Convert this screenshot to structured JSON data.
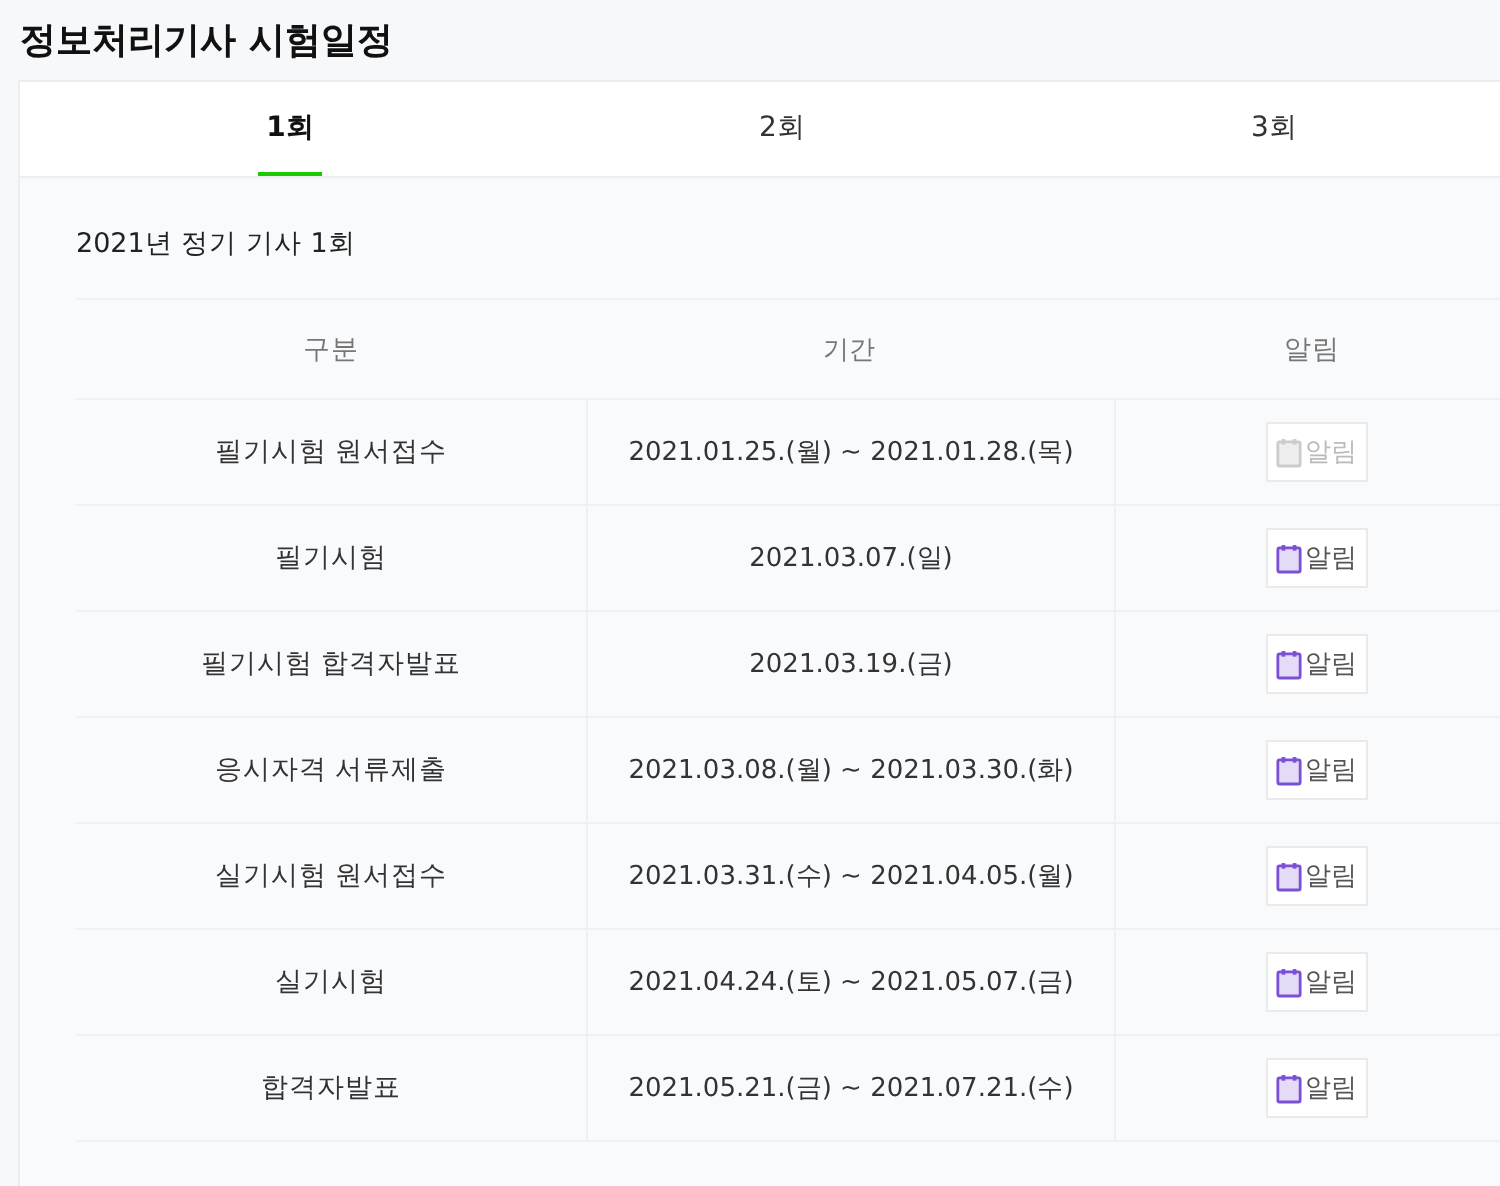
{
  "title": "정보처리기사 시험일정",
  "tabs": [
    {
      "label": "1회",
      "selected": true
    },
    {
      "label": "2회",
      "selected": false
    },
    {
      "label": "3회",
      "selected": false
    }
  ],
  "section_title": "2021년 정기 기사 1회",
  "table": {
    "columns": [
      "구분",
      "기간",
      "알림"
    ],
    "rows": [
      {
        "name": "필기시험 원서접수",
        "period": "2021.01.25.(월) ~ 2021.01.28.(목)",
        "alarm": "알림",
        "disabled": true
      },
      {
        "name": "필기시험",
        "period": "2021.03.07.(일)",
        "alarm": "알림",
        "disabled": false
      },
      {
        "name": "필기시험 합격자발표",
        "period": "2021.03.19.(금)",
        "alarm": "알림",
        "disabled": false
      },
      {
        "name": "응시자격 서류제출",
        "period": "2021.03.08.(월) ~ 2021.03.30.(화)",
        "alarm": "알림",
        "disabled": false
      },
      {
        "name": "실기시험 원서접수",
        "period": "2021.03.31.(수) ~ 2021.04.05.(월)",
        "alarm": "알림",
        "disabled": false
      },
      {
        "name": "실기시험",
        "period": "2021.04.24.(토) ~ 2021.05.07.(금)",
        "alarm": "알림",
        "disabled": false
      },
      {
        "name": "합격자발표",
        "period": "2021.05.21.(금) ~ 2021.07.21.(수)",
        "alarm": "알림",
        "disabled": false
      }
    ]
  }
}
